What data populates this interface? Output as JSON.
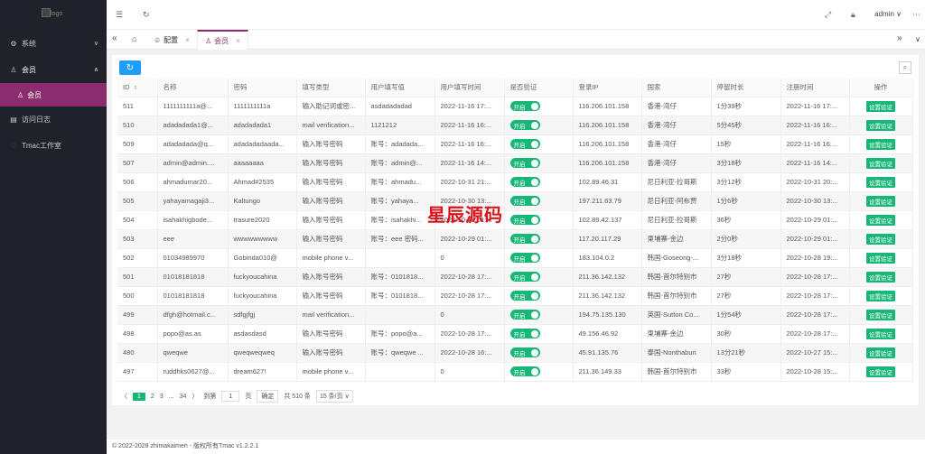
{
  "sidebar": {
    "logo_alt": "logo",
    "items": [
      {
        "label": "系统",
        "icon": "gear-icon"
      },
      {
        "label": "会员",
        "icon": "user-icon"
      },
      {
        "label": "会员",
        "icon": "user-icon"
      },
      {
        "label": "访问日志",
        "icon": "log-icon"
      },
      {
        "label": "Tmac工作室",
        "icon": "heart-icon"
      }
    ]
  },
  "header": {
    "admin": "admin"
  },
  "tabs": [
    {
      "label": "配置",
      "icon": "smile-icon"
    },
    {
      "label": "会员",
      "icon": "user-icon"
    }
  ],
  "table": {
    "headers": [
      "ID",
      "名称",
      "密码",
      "填写类型",
      "用户填写值",
      "用户填写时间",
      "是否验证",
      "登录IP",
      "国家",
      "停留时长",
      "注册时间",
      "操作"
    ],
    "switch_label": "开启",
    "action_label": "设置验证",
    "rows": [
      [
        "511",
        "1111111111a@...",
        "1111111111a",
        "输入助记词或密...",
        "asdadadadad",
        "2022-11-16 17:...",
        "116.206.101.158",
        "香港-湾仔",
        "1分39秒",
        "2022-11-16 17:..."
      ],
      [
        "510",
        "adadadada1@...",
        "adadadada1",
        "mail verification...",
        "1121212",
        "2022-11-16 16:...",
        "116.206.101.158",
        "香港-湾仔",
        "5分45秒",
        "2022-11-16 16:..."
      ],
      [
        "509",
        "adadadada@q...",
        "adadadadaada...",
        "输入账号密码",
        "账号：adadada...",
        "2022-11-16 16:...",
        "116.206.101.158",
        "香港-湾仔",
        "15秒",
        "2022-11-16 16:..."
      ],
      [
        "507",
        "admin@admin....",
        "aaaaaaaa",
        "输入账号密码",
        "账号：admin@...",
        "2022-11-16 14:...",
        "116.206.101.158",
        "香港-湾仔",
        "3分18秒",
        "2022-11-16 14:..."
      ],
      [
        "506",
        "ahmadumar20...",
        "Ahmad#2535",
        "输入账号密码",
        "账号：ahmadu...",
        "2022-10-31 21:...",
        "102.89.46.31",
        "尼日利亚-拉哥斯",
        "3分12秒",
        "2022-10-31 20:..."
      ],
      [
        "505",
        "yahayamagaji3...",
        "Kaltungo",
        "输入账号密码",
        "账号：yahaya...",
        "2022-10-30 13:...",
        "197.211.63.79",
        "尼日利亚-阿布贾",
        "1分6秒",
        "2022-10-30 13:..."
      ],
      [
        "504",
        "isahakhigbode...",
        "trasure2020",
        "输入账号密码",
        "账号：isahakhi...",
        "2022-10-29 01:...",
        "102.89.42.137",
        "尼日利亚-拉哥斯",
        "36秒",
        "2022-10-29 01:..."
      ],
      [
        "503",
        "eee",
        "wwwwwwwww",
        "输入账号密码",
        "账号：eee 密码...",
        "2022-10-29 01:...",
        "117.20.117.29",
        "柬埔寨-金边",
        "2分0秒",
        "2022-10-29 01:..."
      ],
      [
        "502",
        "01034989970",
        "Gobinda010@",
        "mobile phone v...",
        "",
        "0",
        "183.104.0.2",
        "韩国-Goseong-...",
        "3分18秒",
        "2022-10-28 19:..."
      ],
      [
        "501",
        "01018181818",
        "fuckyoucahina",
        "输入账号密码",
        "账号：0101818...",
        "2022-10-28 17:...",
        "211.36.142.132",
        "韩国-首尔特别市",
        "27秒",
        "2022-10-28 17:..."
      ],
      [
        "500",
        "01018181818",
        "fuckyoucahina",
        "输入账号密码",
        "账号：0101818...",
        "2022-10-28 17:...",
        "211.36.142.132",
        "韩国-首尔特别市",
        "27秒",
        "2022-10-28 17:..."
      ],
      [
        "499",
        "dfgh@hotmail.c...",
        "sdfgjfgj",
        "mail verification...",
        "",
        "0",
        "194.75.135.130",
        "英国-Sutton Co...",
        "1分54秒",
        "2022-10-28 17:..."
      ],
      [
        "498",
        "popo@as.as",
        "asdasdasd",
        "输入账号密码",
        "账号：popo@a...",
        "2022-10-28 17:...",
        "49.156.46.92",
        "柬埔寨-金边",
        "30秒",
        "2022-10-28 17:..."
      ],
      [
        "480",
        "qweqwe",
        "qweqweqweq",
        "输入账号密码",
        "账号：qweqwe ...",
        "2022-10-28 16:...",
        "45.91.135.76",
        "泰国-Nonthaburi",
        "13分21秒",
        "2022-10-27 15:..."
      ],
      [
        "497",
        "ruddhks0627@...",
        "dream627!",
        "mobile phone v...",
        "",
        "0",
        "211.36.149.33",
        "韩国-首尔特别市",
        "33秒",
        "2022-10-28 15:..."
      ]
    ]
  },
  "pager": {
    "pages": [
      "1",
      "2",
      "3",
      "...",
      "34"
    ],
    "goto_label": "到第",
    "goto_value": "1",
    "page_unit": "页",
    "confirm": "确定",
    "total": "共 510 条",
    "per_page": "15 条/页"
  },
  "footer": "© 2022-2028 zhimakaimen - 版权所有Tmac v1.2.2.1",
  "watermark": "星辰源码"
}
